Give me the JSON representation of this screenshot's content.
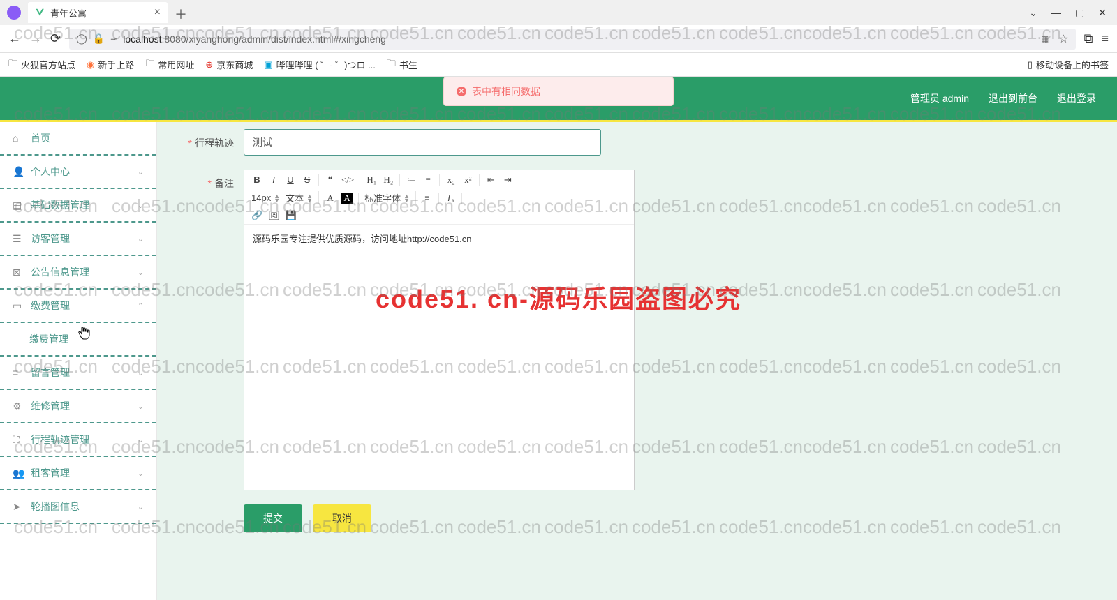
{
  "browser": {
    "tab_title": "青年公寓",
    "url_prefix": "localhost",
    "url_path": ":8080/xiyanghong/admin/dist/index.html#/xingcheng",
    "bookmarks": [
      "火狐官方站点",
      "新手上路",
      "常用网址",
      "京东商城",
      "哔哩哔哩 ( ゜- ゜)つロ ...",
      "书生"
    ],
    "bookmark_right": "移动设备上的书签"
  },
  "header": {
    "admin_label": "管理员 admin",
    "exit_front": "退出到前台",
    "logout": "退出登录"
  },
  "alert": {
    "message": "表中有相同数据"
  },
  "sidebar": {
    "items": [
      {
        "label": "首页",
        "icon": "home",
        "expandable": false
      },
      {
        "label": "个人中心",
        "icon": "user",
        "expandable": true
      },
      {
        "label": "基础数据管理",
        "icon": "db",
        "expandable": true
      },
      {
        "label": "访客管理",
        "icon": "list",
        "expandable": true
      },
      {
        "label": "公告信息管理",
        "icon": "close-box",
        "expandable": true
      },
      {
        "label": "缴费管理",
        "icon": "wallet",
        "expandable": true,
        "open": true,
        "children": [
          {
            "label": "缴费管理"
          }
        ]
      },
      {
        "label": "留言管理",
        "icon": "lines",
        "expandable": true
      },
      {
        "label": "维修管理",
        "icon": "tool",
        "expandable": true
      },
      {
        "label": "行程轨迹管理",
        "icon": "track",
        "expandable": true
      },
      {
        "label": "租客管理",
        "icon": "people",
        "expandable": true
      },
      {
        "label": "轮播图信息",
        "icon": "send",
        "expandable": true
      }
    ]
  },
  "form": {
    "trajectory_label": "行程轨迹",
    "trajectory_value": "测试",
    "remark_label": "备注",
    "editor": {
      "font_size": "14px",
      "para_type": "文本",
      "font_family": "标准字体",
      "h1": "H₁",
      "h2": "H₂",
      "content": "源码乐园专注提供优质源码，访问地址http://code51.cn"
    },
    "submit": "提交",
    "cancel": "取消"
  },
  "watermark": {
    "small": "code51.cn",
    "center": "code51. cn-源码乐园盗图必究"
  }
}
